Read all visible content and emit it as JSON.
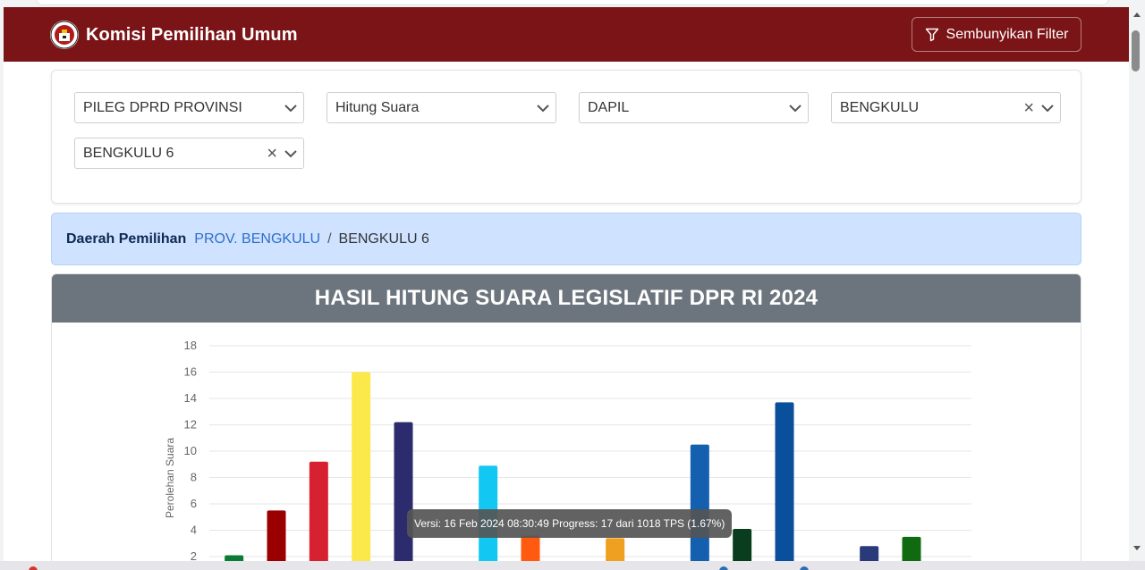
{
  "brand": {
    "title": "Komisi Pemilihan Umum"
  },
  "navbar": {
    "filter_button_label": "Sembunyikan Filter"
  },
  "filters": {
    "election_type": "PILEG DPRD PROVINSI",
    "count_type": "Hitung Suara",
    "level": "DAPIL",
    "province": "BENGKULU",
    "district": "BENGKULU 6"
  },
  "breadcrumb": {
    "label": "Daerah Pemilihan",
    "link": "PROV. BENGKULU",
    "separator": "/",
    "current": "BENGKULU 6"
  },
  "chart_title": "HASIL HITUNG SUARA LEGISLATIF DPR RI 2024",
  "tooltip": "Versi: 16 Feb 2024 08:30:49 Progress: 17 dari 1018 TPS (1.67%)",
  "chart_data": {
    "type": "bar",
    "title": "HASIL HITUNG SUARA LEGISLATIF DPR RI 2024",
    "xlabel": "",
    "ylabel": "Perolehan Suara",
    "ylim": [
      0,
      18
    ],
    "yticks": [
      2,
      4,
      6,
      8,
      10,
      12,
      14,
      16,
      18
    ],
    "grid": true,
    "values": [
      2.1,
      5.5,
      9.2,
      16,
      12.2,
      0,
      8.9,
      3.6,
      0,
      3.4,
      0,
      10.5,
      4.1,
      13.7,
      0,
      2.8,
      3.5
    ],
    "colors": [
      "#0a7a35",
      "#9b0000",
      "#d62230",
      "#fbe94c",
      "#2b2b6e",
      "#cccccc",
      "#12c8f2",
      "#ff5a10",
      "#cccccc",
      "#f0a020",
      "#cccccc",
      "#1460ae",
      "#0a3d1e",
      "#0a4f9c",
      "#cccccc",
      "#283a7a",
      "#106b10"
    ]
  }
}
